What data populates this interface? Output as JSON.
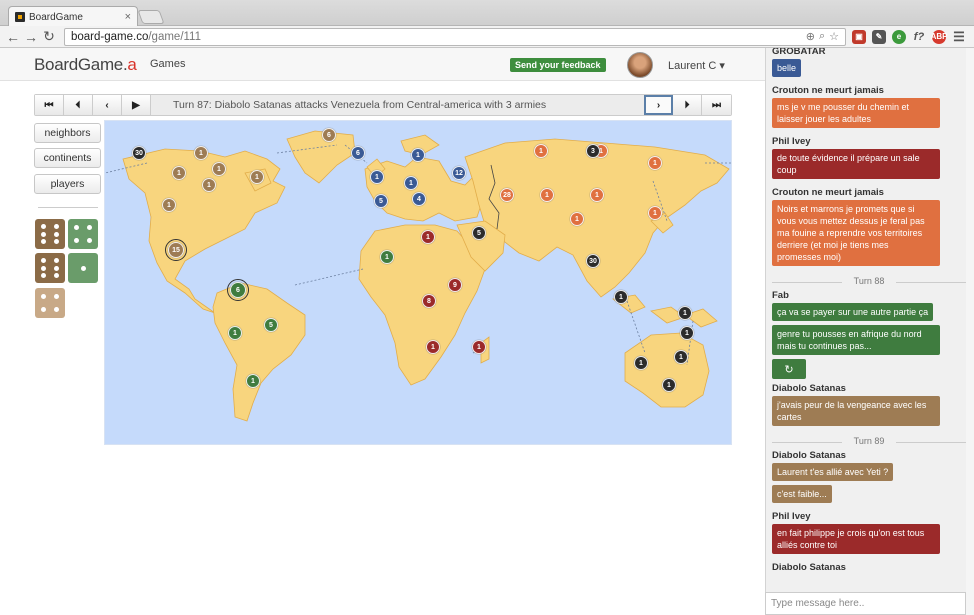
{
  "browser": {
    "tab_title": "BoardGame",
    "tab_close": "×",
    "url_host": "board-game.co",
    "url_path": "/game/111"
  },
  "header": {
    "logo_main": "BoardGame.",
    "logo_accent": "a",
    "games_link": "Games",
    "feedback_label": "Send your feedback",
    "user_name": "Laurent C ▾"
  },
  "turnbar": {
    "first": "⏮",
    "prev": "⏴",
    "back": "‹",
    "play": "▶",
    "text": "Turn 87: Diabolo Satanas attacks Venezuela from Central-america with 3 armies",
    "next": "›",
    "step_end": "⏵",
    "last": "⏭"
  },
  "side_buttons": {
    "neighbors": "neighbors",
    "continents": "continents",
    "players": "players"
  },
  "dice": [
    {
      "color": "#8b6b47",
      "pips": 6
    },
    {
      "color": "#6a9c6a",
      "pips": 4
    },
    {
      "color": "#8b6b47",
      "pips": 6
    },
    {
      "color": "#6a9c6a",
      "pips": 1
    },
    {
      "color": "#c8a987",
      "pips": 4
    }
  ],
  "player_colors": {
    "orange": "#e07040",
    "blue": "#3a5a95",
    "brown": "#9e7c54",
    "red": "#9b2a2a",
    "black": "#2c2c2c",
    "green": "#3f7c3f"
  },
  "armies": [
    {
      "c": "black",
      "n": "30"
    },
    {
      "c": "brown",
      "n": "1"
    },
    {
      "c": "brown",
      "n": "1"
    },
    {
      "c": "brown",
      "n": "1"
    },
    {
      "c": "brown",
      "n": "1"
    },
    {
      "c": "brown",
      "n": "1"
    },
    {
      "c": "brown",
      "n": "1"
    },
    {
      "c": "brown",
      "n": "6"
    },
    {
      "c": "brown",
      "n": "15"
    },
    {
      "c": "green",
      "n": "6"
    },
    {
      "c": "green",
      "n": "1"
    },
    {
      "c": "green",
      "n": "5"
    },
    {
      "c": "green",
      "n": "1"
    },
    {
      "c": "blue",
      "n": "6"
    },
    {
      "c": "blue",
      "n": "1"
    },
    {
      "c": "blue",
      "n": "1"
    },
    {
      "c": "blue",
      "n": "1"
    },
    {
      "c": "blue",
      "n": "5"
    },
    {
      "c": "blue",
      "n": "4"
    },
    {
      "c": "blue",
      "n": "12"
    },
    {
      "c": "orange",
      "n": "1"
    },
    {
      "c": "orange",
      "n": "1"
    },
    {
      "c": "black",
      "n": "3"
    },
    {
      "c": "orange",
      "n": "1"
    },
    {
      "c": "orange",
      "n": "28"
    },
    {
      "c": "orange",
      "n": "1"
    },
    {
      "c": "orange",
      "n": "1"
    },
    {
      "c": "orange",
      "n": "1"
    },
    {
      "c": "orange",
      "n": "1"
    },
    {
      "c": "red",
      "n": "1"
    },
    {
      "c": "black",
      "n": "5"
    },
    {
      "c": "green",
      "n": "1"
    },
    {
      "c": "red",
      "n": "9"
    },
    {
      "c": "red",
      "n": "8"
    },
    {
      "c": "red",
      "n": "1"
    },
    {
      "c": "red",
      "n": "1"
    },
    {
      "c": "black",
      "n": "30"
    },
    {
      "c": "black",
      "n": "1"
    },
    {
      "c": "black",
      "n": "1"
    },
    {
      "c": "black",
      "n": "1"
    },
    {
      "c": "black",
      "n": "1"
    },
    {
      "c": "black",
      "n": "1"
    },
    {
      "c": "black",
      "n": "1"
    }
  ],
  "chat": {
    "top_name": "GROBATAR",
    "messages": [
      {
        "type": "bubble",
        "color": "b-blue",
        "text": "belle"
      },
      {
        "type": "name",
        "text": "Crouton ne meurt jamais"
      },
      {
        "type": "bubble",
        "color": "b-orange",
        "text": "ms je v me pousser du chemin et laisser jouer les adultes"
      },
      {
        "type": "name",
        "text": "Phil Ivey"
      },
      {
        "type": "bubble",
        "color": "b-red",
        "text": "de toute évidence il prépare un sale coup"
      },
      {
        "type": "name",
        "text": "Crouton ne meurt jamais"
      },
      {
        "type": "bubble",
        "color": "b-orange",
        "text": "Noirs et marrons je promets que si vous vous mettez dessus je feral pas ma fouine a reprendre vos territoires derriere (et moi je tiens mes promesses moi)"
      },
      {
        "type": "turn",
        "text": "Turn 88"
      },
      {
        "type": "name",
        "text": "Fab"
      },
      {
        "type": "bubble",
        "color": "b-green",
        "text": "ça va se payer sur une autre partie ça"
      },
      {
        "type": "bubble",
        "color": "b-green",
        "text": "genre tu pousses en afrique du nord mais tu continues pas..."
      },
      {
        "type": "refresh",
        "text": "↻"
      },
      {
        "type": "name",
        "text": "Diabolo Satanas"
      },
      {
        "type": "bubble",
        "color": "b-brown",
        "text": "j'avais peur de la vengeance avec les cartes"
      },
      {
        "type": "turn",
        "text": "Turn 89"
      },
      {
        "type": "name",
        "text": "Diabolo Satanas"
      },
      {
        "type": "bubble",
        "color": "b-brown",
        "text": "Laurent t'es allié avec Yeti ?"
      },
      {
        "type": "bubble",
        "color": "b-brown",
        "text": "c'est faible..."
      },
      {
        "type": "name",
        "text": "Phil Ivey"
      },
      {
        "type": "bubble",
        "color": "b-red",
        "text": "en fait philippe je crois qu'on est tous alliés contre toi"
      },
      {
        "type": "name",
        "text": "Diabolo Satanas"
      }
    ],
    "input_placeholder": "Type message here.."
  }
}
